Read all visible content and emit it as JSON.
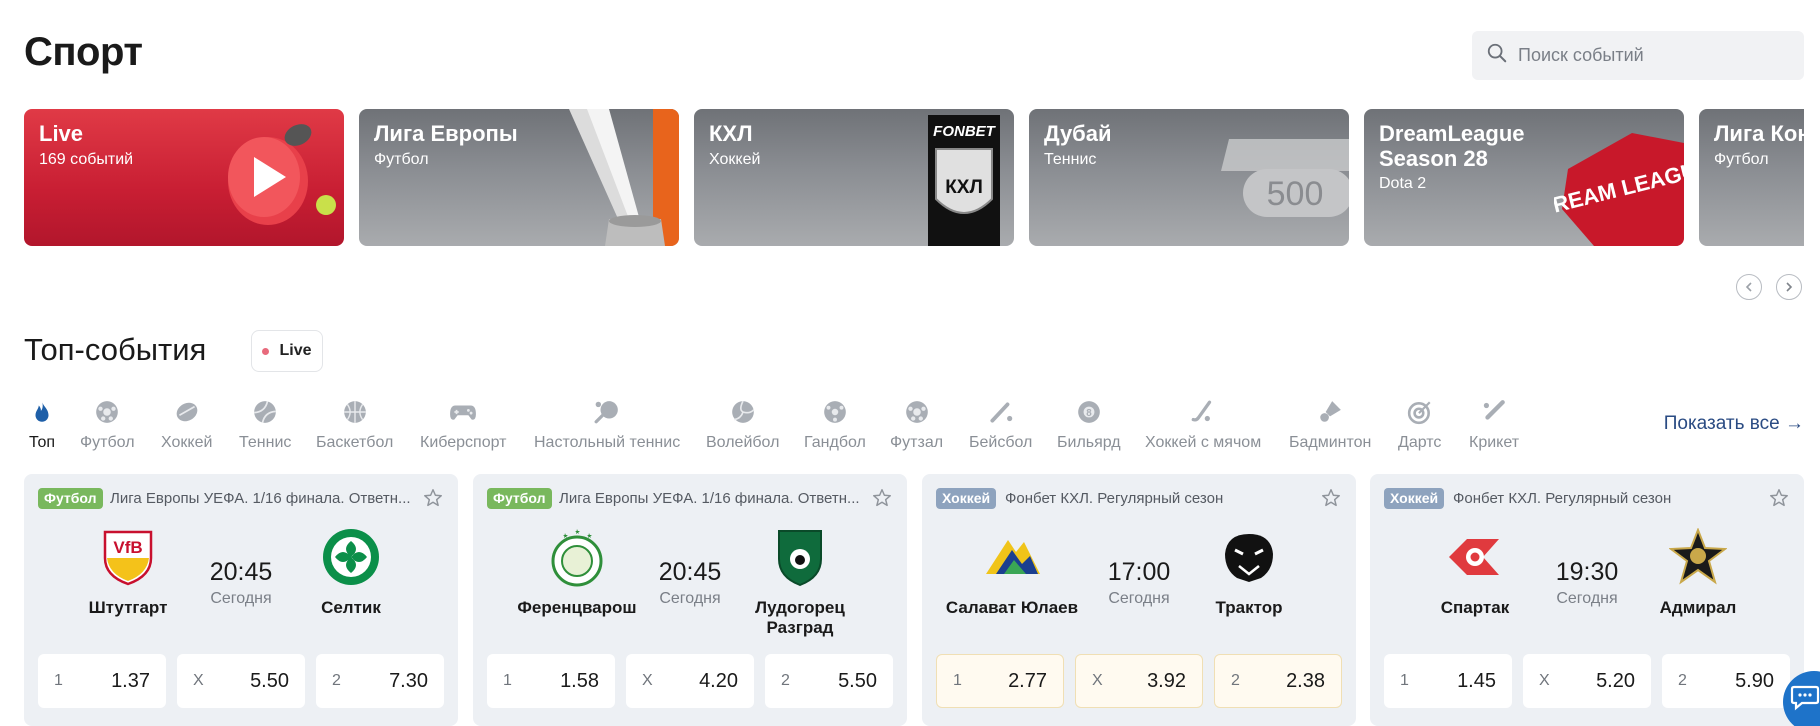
{
  "header": {
    "title": "Спорт",
    "search_placeholder": "Поиск событий"
  },
  "banners": [
    {
      "title": "Live",
      "subtitle": "169 событий"
    },
    {
      "title": "Лига Европы",
      "subtitle": "Футбол"
    },
    {
      "title": "КХЛ",
      "subtitle": "Хоккей",
      "logo_text": "FONBET",
      "crest_letters": "КХЛ"
    },
    {
      "title": "Дубай",
      "subtitle": "Теннис",
      "logo_text": "500"
    },
    {
      "title": "DreamLeague Season 28",
      "subtitle": "Dota 2",
      "logo_text": "DREAM LEAGUE"
    },
    {
      "title": "Лига Кон",
      "subtitle": "Футбол"
    }
  ],
  "top_events": {
    "title": "Топ-события",
    "live_label": "Live",
    "show_all": "Показать все →"
  },
  "sports": [
    {
      "label": "Топ",
      "icon": "fire-icon",
      "active": true
    },
    {
      "label": "Футбол",
      "icon": "soccer-ball-icon"
    },
    {
      "label": "Хоккей",
      "icon": "hockey-puck-icon"
    },
    {
      "label": "Теннис",
      "icon": "tennis-ball-icon"
    },
    {
      "label": "Баскетбол",
      "icon": "basketball-icon"
    },
    {
      "label": "Киберспорт",
      "icon": "gamepad-icon"
    },
    {
      "label": "Настольный теннис",
      "icon": "ping-pong-icon"
    },
    {
      "label": "Волейбол",
      "icon": "volleyball-icon"
    },
    {
      "label": "Гандбол",
      "icon": "handball-icon"
    },
    {
      "label": "Футзал",
      "icon": "futsal-ball-icon"
    },
    {
      "label": "Бейсбол",
      "icon": "baseball-bat-icon"
    },
    {
      "label": "Бильярд",
      "icon": "billiard-ball-icon"
    },
    {
      "label": "Хоккей с мячом",
      "icon": "bandy-stick-icon"
    },
    {
      "label": "Бадминтон",
      "icon": "shuttlecock-icon"
    },
    {
      "label": "Дартс",
      "icon": "dartboard-icon"
    },
    {
      "label": "Крикет",
      "icon": "cricket-bat-icon"
    }
  ],
  "events": [
    {
      "sport": "Футбол",
      "league": "Лига Европы УЕФА. 1/16 финала. Ответн...",
      "home": "Штутгарт",
      "away": "Селтик",
      "time": "20:45",
      "date": "Сегодня",
      "home_logo_text": "VfB",
      "odds": [
        {
          "k": "1",
          "v": "1.37"
        },
        {
          "k": "X",
          "v": "5.50"
        },
        {
          "k": "2",
          "v": "7.30"
        }
      ]
    },
    {
      "sport": "Футбол",
      "league": "Лига Европы УЕФА. 1/16 финала. Ответн...",
      "home": "Ференцварош",
      "away": "Лудогорец Разград",
      "time": "20:45",
      "date": "Сегодня",
      "odds": [
        {
          "k": "1",
          "v": "1.58"
        },
        {
          "k": "X",
          "v": "4.20"
        },
        {
          "k": "2",
          "v": "5.50"
        }
      ]
    },
    {
      "sport": "Хоккей",
      "league": "Фонбет КХЛ. Регулярный сезон",
      "home": "Салават Юлаев",
      "away": "Трактор",
      "time": "17:00",
      "date": "Сегодня",
      "odds": [
        {
          "k": "1",
          "v": "2.77"
        },
        {
          "k": "X",
          "v": "3.92"
        },
        {
          "k": "2",
          "v": "2.38"
        }
      ]
    },
    {
      "sport": "Хоккей",
      "league": "Фонбет КХЛ. Регулярный сезон",
      "home": "Спартак",
      "away": "Адмирал",
      "time": "19:30",
      "date": "Сегодня",
      "odds": [
        {
          "k": "1",
          "v": "1.45"
        },
        {
          "k": "X",
          "v": "5.20"
        },
        {
          "k": "2",
          "v": "5.90"
        }
      ]
    }
  ],
  "colors": {
    "live_banner": "#d02437",
    "football_tag": "#79b85d",
    "hockey_tag": "#8ea3be",
    "link": "#2a4b83",
    "chat": "#1e73c9"
  }
}
